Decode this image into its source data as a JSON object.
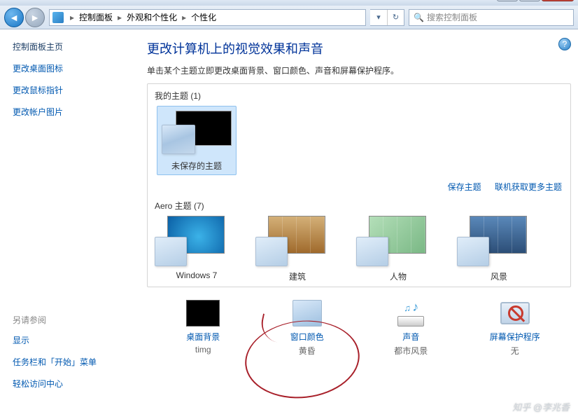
{
  "window": {
    "minimize": "_",
    "maximize": "❐",
    "close": "✕"
  },
  "breadcrumb": {
    "root": "控制面板",
    "level1": "外观和个性化",
    "level2": "个性化",
    "sep": "▸"
  },
  "search": {
    "placeholder": "搜索控制面板"
  },
  "sidebar": {
    "heading": "控制面板主页",
    "links": [
      "更改桌面图标",
      "更改鼠标指针",
      "更改帐户图片"
    ],
    "see_also_heading": "另请参阅",
    "see_also": [
      "显示",
      "任务栏和「开始」菜单",
      "轻松访问中心"
    ]
  },
  "content": {
    "title": "更改计算机上的视觉效果和声音",
    "subtitle": "单击某个主题立即更改桌面背景、窗口颜色、声音和屏幕保护程序。",
    "my_themes_label": "我的主题 (1)",
    "unsaved_theme": "未保存的主题",
    "save_theme": "保存主题",
    "get_more_themes": "联机获取更多主题",
    "aero_label": "Aero 主题 (7)",
    "aero_items": [
      "Windows 7",
      "建筑",
      "人物",
      "风景"
    ]
  },
  "bottom": {
    "wallpaper": {
      "title": "桌面背景",
      "sub": "timg"
    },
    "color": {
      "title": "窗口颜色",
      "sub": "黄昏"
    },
    "sound": {
      "title": "声音",
      "sub": "都市风景"
    },
    "saver": {
      "title": "屏幕保护程序",
      "sub": "无"
    }
  },
  "watermark": "知乎 @李兆香",
  "help": "?"
}
